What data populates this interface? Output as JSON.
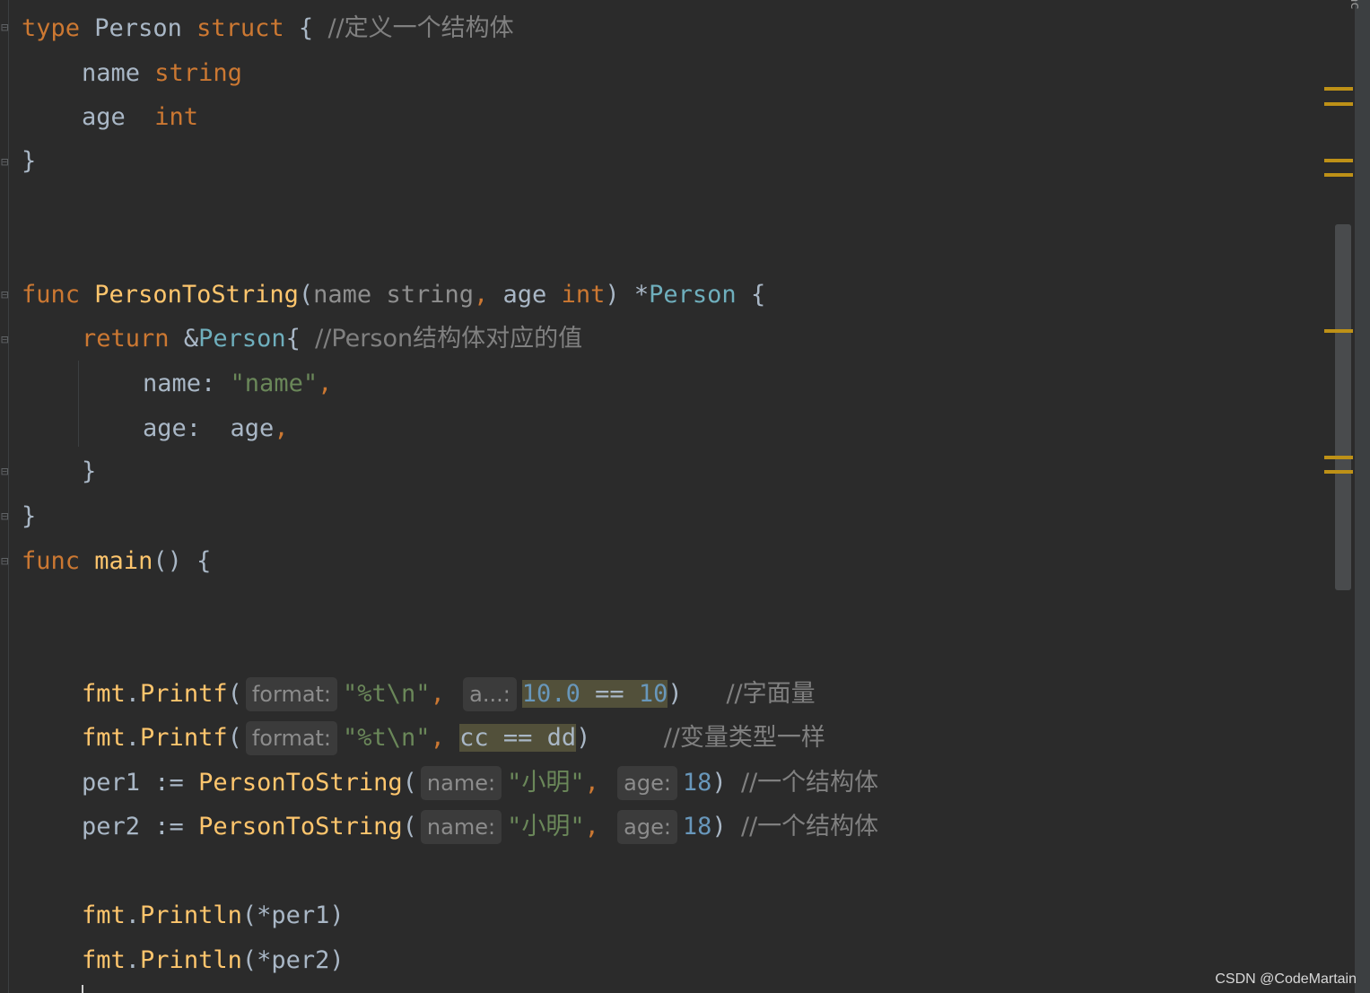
{
  "code": {
    "l1": {
      "kw1": "type",
      "name": "Person",
      "kw2": "struct",
      "brace": "{",
      "comment": "//定义一个结构体"
    },
    "l2": {
      "field": "name",
      "type": "string"
    },
    "l3": {
      "field": "age",
      "type": "int"
    },
    "l4": {
      "brace": "}"
    },
    "l5": {
      "kw": "func",
      "name": "PersonToString",
      "open": "(",
      "p1": "name",
      "t1": "string",
      "comma": ",",
      "p2": "age",
      "t2": "int",
      "close": ")",
      "star": "*",
      "ret": "Person",
      "brace": "{"
    },
    "l6": {
      "kw": "return",
      "amp": "&",
      "type": "Person",
      "brace": "{",
      "comment": "//Person结构体对应的值"
    },
    "l7": {
      "key": "name:",
      "val": "\"name\"",
      "comma": ","
    },
    "l8": {
      "key": "age:",
      "val": "age",
      "comma": ","
    },
    "l9": {
      "brace": "}"
    },
    "l10": {
      "brace": "}"
    },
    "l11": {
      "kw": "func",
      "name": "main",
      "rest": "() {"
    },
    "l12": {
      "pkg": "fmt",
      "dot": ".",
      "fn": "Printf",
      "open": "(",
      "hint1": "format:",
      "str": "\"%t\\n\"",
      "comma": ",",
      "hint2": "a...:",
      "n1": "10.0",
      "op": "==",
      "n2": "10",
      "close": ")",
      "comment": "//字面量"
    },
    "l13": {
      "pkg": "fmt",
      "dot": ".",
      "fn": "Printf",
      "open": "(",
      "hint1": "format:",
      "str": "\"%t\\n\"",
      "comma": ",",
      "expr": "cc == dd",
      "close": ")",
      "comment": "//变量类型一样"
    },
    "l14": {
      "var": "per1",
      "assign": ":=",
      "fn": "PersonToString",
      "open": "(",
      "hint1": "name:",
      "str": "\"小明\"",
      "comma": ",",
      "hint2": "age:",
      "num": "18",
      "close": ")",
      "comment": "//一个结构体"
    },
    "l15": {
      "var": "per2",
      "assign": ":=",
      "fn": "PersonToString",
      "open": "(",
      "hint1": "name:",
      "str": "\"小明\"",
      "comma": ",",
      "hint2": "age:",
      "num": "18",
      "close": ")",
      "comment": "//一个结构体"
    },
    "l16": {
      "pkg": "fmt",
      "dot": ".",
      "fn": "Println",
      "args": "(*per1)"
    },
    "l17": {
      "pkg": "fmt",
      "dot": ".",
      "fn": "Println",
      "args": "(*per2)"
    }
  },
  "sidebar_label": "ac",
  "watermark": "CSDN @CodeMartain",
  "colors": {
    "keyword": "#cc7832",
    "function": "#ffc66d",
    "type": "#6fafbd",
    "string": "#6a8759",
    "number": "#6897bb",
    "comment": "#808080",
    "marker": "#be9117"
  }
}
